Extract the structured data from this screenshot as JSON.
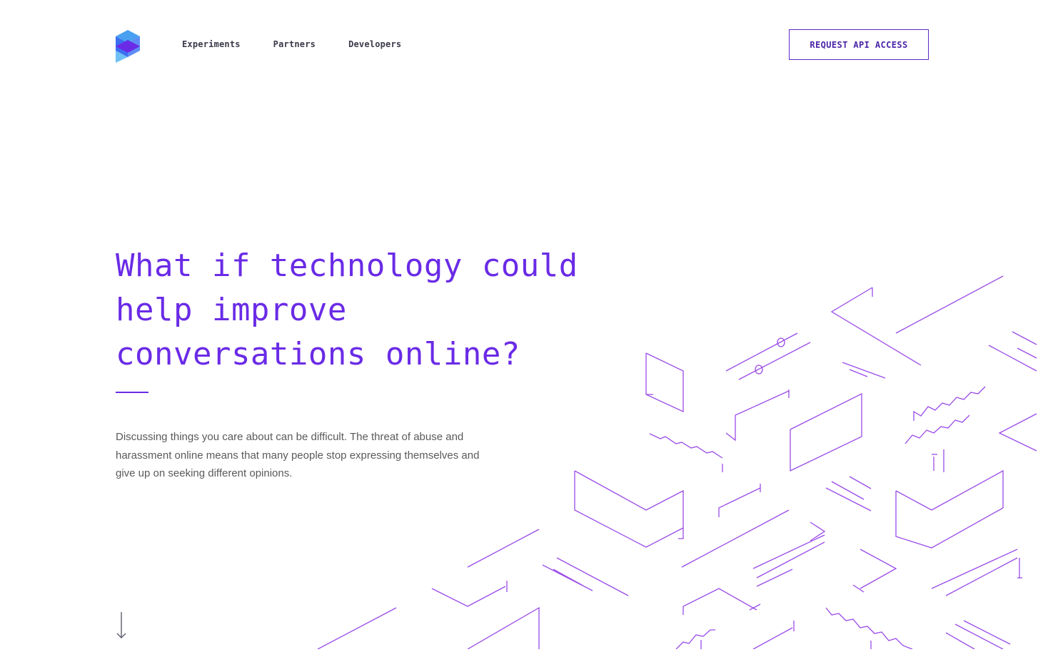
{
  "header": {
    "logo": "cube-logo-icon",
    "nav": [
      {
        "label": "Experiments"
      },
      {
        "label": "Partners"
      },
      {
        "label": "Developers"
      }
    ],
    "cta_label": "REQUEST API ACCESS"
  },
  "hero": {
    "headline_lines": [
      "What if technology could",
      "help improve",
      "conversations online?"
    ],
    "body": "Discussing things you care about can be difficult. The threat of abuse and harassment online means that many people stop expressing themselves and give up on seeking different opinions.",
    "scroll_icon": "arrow-down-icon",
    "illustration_icon": "isometric-line-illustration"
  },
  "colors": {
    "accent": "#6a2be6",
    "illustration": "#9a4be8",
    "cta_border": "#5a2bc4",
    "body_text": "#5a5a5a",
    "nav_text": "#3a3a4a"
  }
}
